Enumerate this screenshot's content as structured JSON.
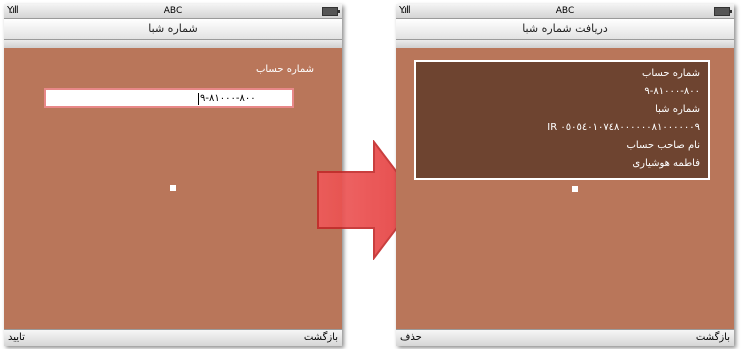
{
  "left_screen": {
    "status": {
      "carrier": "ABC"
    },
    "title": "شماره شبا",
    "field_label": "شماره حساب",
    "input_value": "٨٠٠-٨١٠٠٠-٩",
    "softkeys": {
      "left": "تایید",
      "right": "بازگشت"
    }
  },
  "right_screen": {
    "status": {
      "carrier": "ABC"
    },
    "title": "دریافت شماره شبا",
    "info": {
      "account_label": "شماره حساب",
      "account_value": "٨٠٠-٨١٠٠٠-٩",
      "sheba_label": "شماره شبا",
      "sheba_value": "IR ٠٥٠٥٤٠١٠٧٤٨٠٠٠٠٠٠٨١٠٠٠٠٠٠٩",
      "owner_label": "نام صاحب حساب",
      "owner_value": "فاطمه هوشیاری"
    },
    "softkeys": {
      "left": "حذف",
      "right": "بازگشت"
    }
  },
  "colors": {
    "screen_bg": "#b9765a",
    "info_box_bg": "#6e4430",
    "input_border": "#e88888",
    "arrow_fill": "#e94b4b"
  }
}
